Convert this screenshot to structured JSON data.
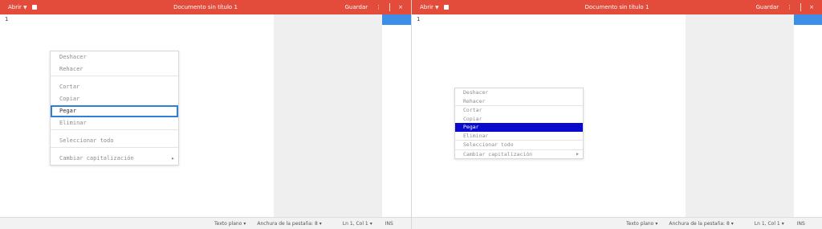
{
  "header": {
    "open_label": "Abrir",
    "title": "Documento sin título 1",
    "save_label": "Guardar",
    "close_glyph": "×",
    "menu_glyph": "⋮",
    "color": "#e34b3b"
  },
  "editor": {
    "line_number": "1"
  },
  "status": {
    "syntax": "Texto plano",
    "tab_width": "Anchura de la pestaña: 8",
    "cursor": "Ln 1, Col 1",
    "mode": "INS"
  },
  "menu": {
    "undo": "Deshacer",
    "redo": "Rehacer",
    "cut": "Cortar",
    "copy": "Copiar",
    "paste": "Pegar",
    "delete": "Eliminar",
    "select_all": "Seleccionar todo",
    "change_case": "Cambiar capitalización"
  },
  "icons": {
    "document": "document-icon",
    "chevron": "chevron-down-icon",
    "submenu": "submenu-arrow-icon"
  }
}
